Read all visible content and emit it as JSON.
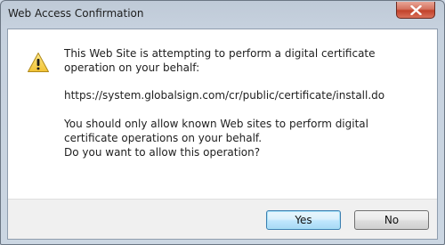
{
  "window": {
    "title": "Web Access Confirmation"
  },
  "dialog": {
    "icon": "warning-icon",
    "message": "This Web Site is attempting to perform a digital certificate operation on your behalf:",
    "url": "https://system.globalsign.com/cr/public/certificate/install.do",
    "warning_line1": "You should only allow known Web sites to perform digital certificate operations on your behalf.",
    "warning_line2": "Do you want to allow this operation?"
  },
  "buttons": {
    "yes_label": "Yes",
    "no_label": "No"
  },
  "colors": {
    "accent": "#3c7fb1",
    "close_button": "#c2422a",
    "warning_yellow": "#f7d44a"
  }
}
